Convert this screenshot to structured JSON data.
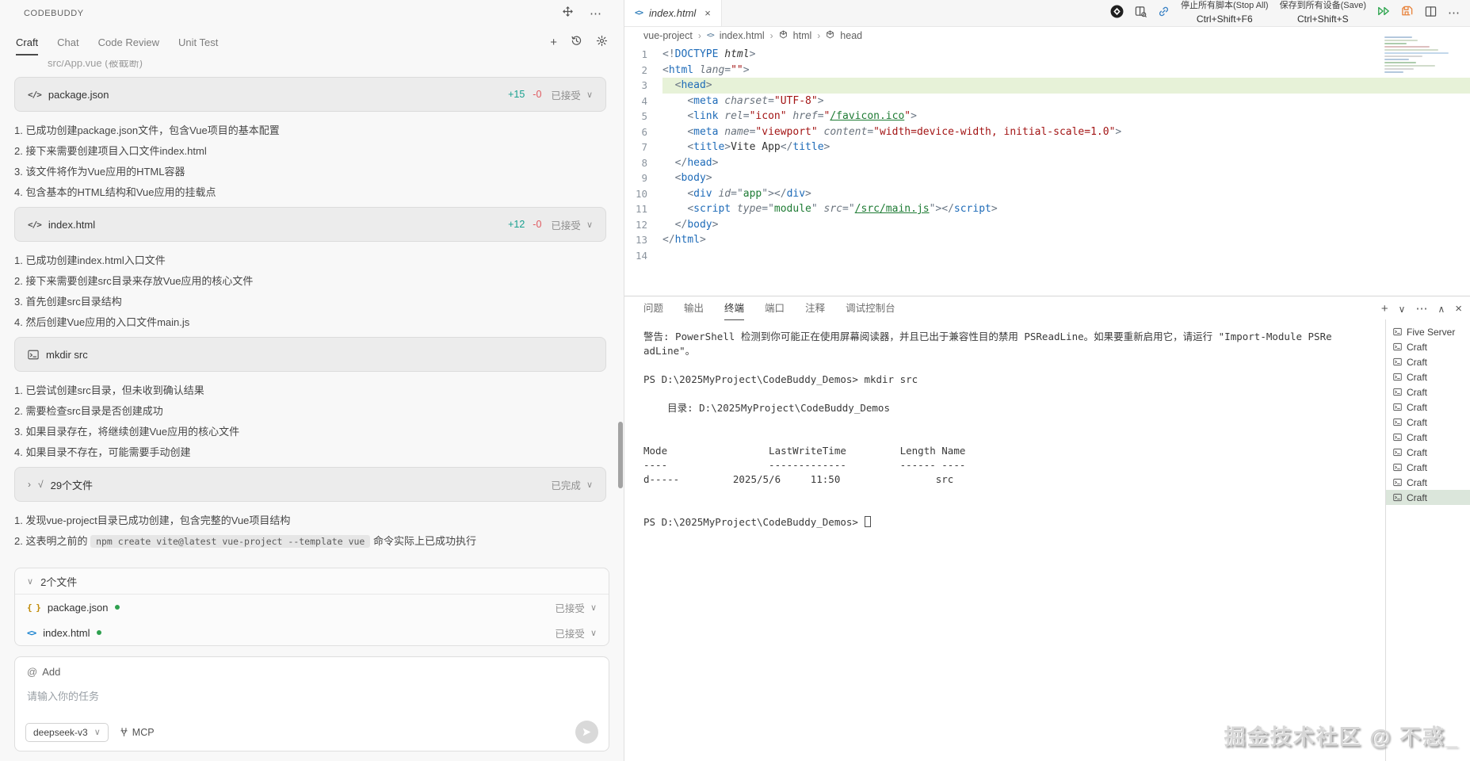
{
  "app": {
    "title": "CODEBUDDY"
  },
  "icons": {
    "code_file": "</>",
    "braces": "{ }",
    "angle": "<>",
    "chevron_down": "∨",
    "chevron_right": "›",
    "chevron_up": "∧",
    "check": "√",
    "close": "×",
    "plus": "+",
    "ellipsis": "⋯",
    "at": "@",
    "tab_close": "×"
  },
  "sidebar": {
    "tabs": [
      {
        "label": "Craft",
        "active": true
      },
      {
        "label": "Chat",
        "active": false
      },
      {
        "label": "Code Review",
        "active": false
      },
      {
        "label": "Unit Test",
        "active": false
      }
    ],
    "clipped_top_text": "src/App.vue (被截断)",
    "sections": [
      {
        "card": {
          "name": "package.json",
          "added": "+15",
          "removed": "-0",
          "status": "已接受"
        },
        "steps": [
          "1. 已成功创建package.json文件，包含Vue项目的基本配置",
          "2. 接下来需要创建项目入口文件index.html",
          "3. 该文件将作为Vue应用的HTML容器",
          "4. 包含基本的HTML结构和Vue应用的挂载点"
        ]
      },
      {
        "card": {
          "name": "index.html",
          "added": "+12",
          "removed": "-0",
          "status": "已接受"
        },
        "steps": [
          "1. 已成功创建index.html入口文件",
          "2. 接下来需要创建src目录来存放Vue应用的核心文件",
          "3. 首先创建src目录结构",
          "4. 然后创建Vue应用的入口文件main.js"
        ]
      },
      {
        "card": {
          "name": "mkdir src"
        },
        "steps": [
          "1. 已尝试创建src目录，但未收到确认结果",
          "2. 需要检查src目录是否创建成功",
          "3. 如果目录存在，将继续创建Vue应用的核心文件",
          "4. 如果目录不存在，可能需要手动创建"
        ]
      },
      {
        "card": {
          "name": "29个文件",
          "status": "已完成"
        },
        "steps": [
          "1. 发现vue-project目录已成功创建，包含完整的Vue项目结构"
        ],
        "step_with_code": {
          "prefix": "2. 这表明之前的 ",
          "code": "npm create vite@latest vue-project --template vue",
          "suffix": " 命令实际上已成功执行"
        }
      }
    ],
    "files_panel": {
      "header": "2个文件",
      "files": [
        {
          "name": "package.json",
          "status": "已接受"
        },
        {
          "name": "index.html",
          "status": "已接受"
        }
      ]
    },
    "composer": {
      "add_label": "Add",
      "placeholder": "请输入你的任务",
      "model": "deepseek-v3",
      "mcp_label": "MCP"
    }
  },
  "editor": {
    "tab": {
      "name": "index.html"
    },
    "breadcrumb": {
      "project": "vue-project",
      "file": "index.html",
      "el1": "html",
      "el2": "head"
    },
    "actions": {
      "stop_all": {
        "label": "停止所有脚本(Stop All)",
        "key": "Ctrl+Shift+F6"
      },
      "save_all": {
        "label": "保存到所有设备(Save)",
        "key": "Ctrl+Shift+S"
      }
    },
    "code_lines": [
      {
        "n": "1",
        "hl": false,
        "tokens": [
          [
            "p",
            "<!"
          ],
          [
            "tag",
            "DOCTYPE"
          ],
          [
            "txt",
            " "
          ],
          [
            "it",
            "html"
          ],
          [
            "p",
            ">"
          ]
        ]
      },
      {
        "n": "2",
        "hl": false,
        "tokens": [
          [
            "p",
            "<"
          ],
          [
            "tag",
            "html"
          ],
          [
            "txt",
            " "
          ],
          [
            "attr",
            "lang"
          ],
          [
            "p",
            "="
          ],
          [
            "str",
            "\"\""
          ],
          [
            "p",
            ">"
          ]
        ]
      },
      {
        "n": "3",
        "hl": true,
        "tokens": [
          [
            "txt",
            "  "
          ],
          [
            "p",
            "<"
          ],
          [
            "tag",
            "head"
          ],
          [
            "p",
            ">"
          ]
        ]
      },
      {
        "n": "4",
        "hl": false,
        "tokens": [
          [
            "txt",
            "    "
          ],
          [
            "p",
            "<"
          ],
          [
            "tag",
            "meta"
          ],
          [
            "txt",
            " "
          ],
          [
            "attr",
            "charset"
          ],
          [
            "p",
            "="
          ],
          [
            "str",
            "\"UTF-8\""
          ],
          [
            "p",
            ">"
          ]
        ]
      },
      {
        "n": "5",
        "hl": false,
        "tokens": [
          [
            "txt",
            "    "
          ],
          [
            "p",
            "<"
          ],
          [
            "tag",
            "link"
          ],
          [
            "txt",
            " "
          ],
          [
            "attr",
            "rel"
          ],
          [
            "p",
            "="
          ],
          [
            "str",
            "\"icon\""
          ],
          [
            "txt",
            " "
          ],
          [
            "attr",
            "href"
          ],
          [
            "p",
            "="
          ],
          [
            "str",
            "\""
          ],
          [
            "link",
            "/favicon.ico"
          ],
          [
            "str",
            "\""
          ],
          [
            "p",
            ">"
          ]
        ]
      },
      {
        "n": "6",
        "hl": false,
        "tokens": [
          [
            "txt",
            "    "
          ],
          [
            "p",
            "<"
          ],
          [
            "tag",
            "meta"
          ],
          [
            "txt",
            " "
          ],
          [
            "attr",
            "name"
          ],
          [
            "p",
            "="
          ],
          [
            "str",
            "\"viewport\""
          ],
          [
            "txt",
            " "
          ],
          [
            "attr",
            "content"
          ],
          [
            "p",
            "="
          ],
          [
            "str",
            "\"width=device-width, initial-scale=1.0\""
          ],
          [
            "p",
            ">"
          ]
        ]
      },
      {
        "n": "7",
        "hl": false,
        "tokens": [
          [
            "txt",
            "    "
          ],
          [
            "p",
            "<"
          ],
          [
            "tag",
            "title"
          ],
          [
            "p",
            ">"
          ],
          [
            "txt",
            "Vite App"
          ],
          [
            "p",
            "</"
          ],
          [
            "tag",
            "title"
          ],
          [
            "p",
            ">"
          ]
        ]
      },
      {
        "n": "8",
        "hl": false,
        "tokens": [
          [
            "txt",
            "  "
          ],
          [
            "p",
            "</"
          ],
          [
            "tag",
            "head"
          ],
          [
            "p",
            ">"
          ]
        ]
      },
      {
        "n": "9",
        "hl": false,
        "tokens": [
          [
            "txt",
            "  "
          ],
          [
            "p",
            "<"
          ],
          [
            "tag",
            "body"
          ],
          [
            "p",
            ">"
          ]
        ]
      },
      {
        "n": "10",
        "hl": false,
        "tokens": [
          [
            "txt",
            "    "
          ],
          [
            "p",
            "<"
          ],
          [
            "tag",
            "div"
          ],
          [
            "txt",
            " "
          ],
          [
            "attr",
            "id"
          ],
          [
            "p",
            "="
          ],
          [
            "p",
            "\""
          ],
          [
            "val",
            "app"
          ],
          [
            "p",
            "\""
          ],
          [
            "p",
            ">"
          ],
          [
            "p",
            "</"
          ],
          [
            "tag",
            "div"
          ],
          [
            "p",
            ">"
          ]
        ]
      },
      {
        "n": "11",
        "hl": false,
        "tokens": [
          [
            "txt",
            "    "
          ],
          [
            "p",
            "<"
          ],
          [
            "tag",
            "script"
          ],
          [
            "txt",
            " "
          ],
          [
            "attr",
            "type"
          ],
          [
            "p",
            "="
          ],
          [
            "p",
            "\""
          ],
          [
            "val",
            "module"
          ],
          [
            "p",
            "\""
          ],
          [
            "txt",
            " "
          ],
          [
            "attr",
            "src"
          ],
          [
            "p",
            "="
          ],
          [
            "p",
            "\""
          ],
          [
            "link",
            "/src/main.js"
          ],
          [
            "p",
            "\""
          ],
          [
            "p",
            ">"
          ],
          [
            "p",
            "</"
          ],
          [
            "tag",
            "script"
          ],
          [
            "p",
            ">"
          ]
        ]
      },
      {
        "n": "12",
        "hl": false,
        "tokens": [
          [
            "txt",
            "  "
          ],
          [
            "p",
            "</"
          ],
          [
            "tag",
            "body"
          ],
          [
            "p",
            ">"
          ]
        ]
      },
      {
        "n": "13",
        "hl": false,
        "tokens": [
          [
            "p",
            "</"
          ],
          [
            "tag",
            "html"
          ],
          [
            "p",
            ">"
          ]
        ]
      },
      {
        "n": "14",
        "hl": false,
        "tokens": []
      }
    ]
  },
  "terminal": {
    "tabs": [
      {
        "label": "问题",
        "active": false
      },
      {
        "label": "输出",
        "active": false
      },
      {
        "label": "终端",
        "active": true
      },
      {
        "label": "端口",
        "active": false
      },
      {
        "label": "注释",
        "active": false
      },
      {
        "label": "调试控制台",
        "active": false
      }
    ],
    "lines": [
      "警告: PowerShell 检测到你可能正在使用屏幕阅读器，并且已出于兼容性目的禁用 PSReadLine。如果要重新启用它，请运行 \"Import-Module PSRe",
      "adLine\"。",
      "",
      "PS D:\\2025MyProject\\CodeBuddy_Demos> mkdir src",
      "",
      "    目录: D:\\2025MyProject\\CodeBuddy_Demos",
      "",
      "",
      "Mode                 LastWriteTime         Length Name",
      "----                 -------------         ------ ----",
      "d-----         2025/5/6     11:50                src",
      "",
      ""
    ],
    "prompt_line": "PS D:\\2025MyProject\\CodeBuddy_Demos> ",
    "sessions": [
      {
        "name": "Five Server",
        "selected": false
      },
      {
        "name": "Craft",
        "selected": false
      },
      {
        "name": "Craft",
        "selected": false
      },
      {
        "name": "Craft",
        "selected": false
      },
      {
        "name": "Craft",
        "selected": false
      },
      {
        "name": "Craft",
        "selected": false
      },
      {
        "name": "Craft",
        "selected": false
      },
      {
        "name": "Craft",
        "selected": false
      },
      {
        "name": "Craft",
        "selected": false
      },
      {
        "name": "Craft",
        "selected": false
      },
      {
        "name": "Craft",
        "selected": false
      },
      {
        "name": "Craft",
        "selected": true
      }
    ]
  },
  "watermark": "掘金技术社区 @ 不惑_"
}
